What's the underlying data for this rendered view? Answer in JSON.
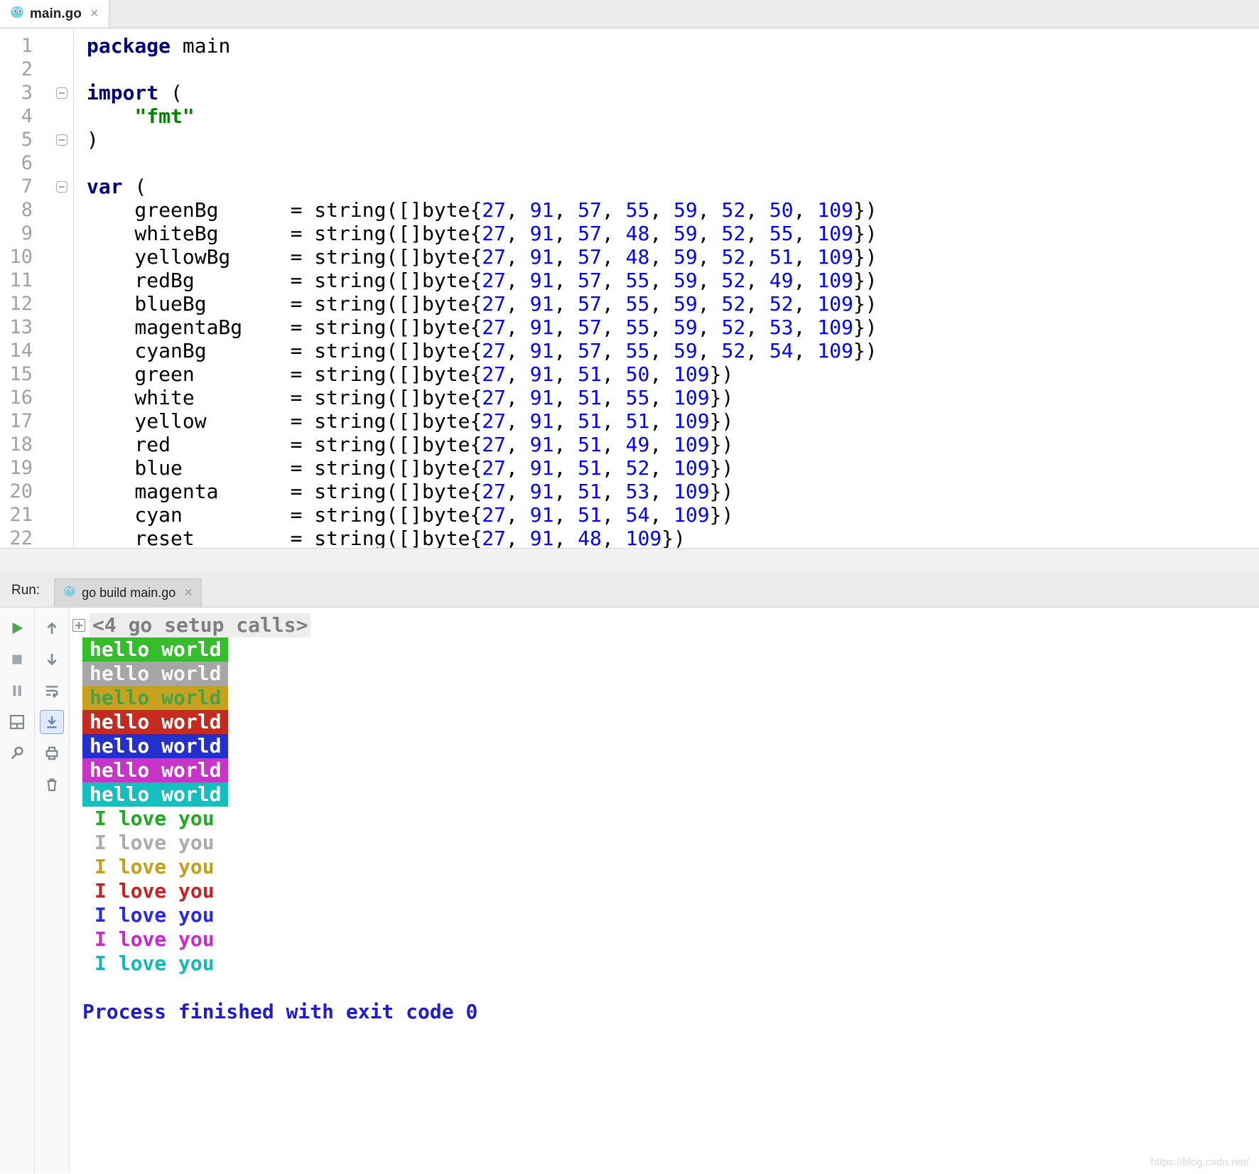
{
  "window": {
    "editor_tab": {
      "title": "main.go",
      "close": "×"
    }
  },
  "editor": {
    "lines": [
      {
        "n": 1,
        "tokens": [
          [
            "kw",
            "package"
          ],
          [
            "pl",
            " main"
          ]
        ]
      },
      {
        "n": 2,
        "tokens": []
      },
      {
        "n": 3,
        "fold": "open",
        "tokens": [
          [
            "kw",
            "import"
          ],
          [
            "pl",
            " ("
          ]
        ]
      },
      {
        "n": 4,
        "tokens": [
          [
            "pl",
            "    "
          ],
          [
            "str",
            "\"fmt\""
          ]
        ]
      },
      {
        "n": 5,
        "fold": "close",
        "tokens": [
          [
            "pl",
            ")"
          ]
        ]
      },
      {
        "n": 6,
        "tokens": []
      },
      {
        "n": 7,
        "fold": "open",
        "tokens": [
          [
            "kw",
            "var"
          ],
          [
            "pl",
            " ("
          ]
        ]
      },
      {
        "n": 8,
        "decl": {
          "name": "greenBg",
          "bytes": [
            27,
            91,
            57,
            55,
            59,
            52,
            50,
            109
          ]
        }
      },
      {
        "n": 9,
        "decl": {
          "name": "whiteBg",
          "bytes": [
            27,
            91,
            57,
            48,
            59,
            52,
            55,
            109
          ]
        }
      },
      {
        "n": 10,
        "decl": {
          "name": "yellowBg",
          "bytes": [
            27,
            91,
            57,
            48,
            59,
            52,
            51,
            109
          ]
        }
      },
      {
        "n": 11,
        "decl": {
          "name": "redBg",
          "bytes": [
            27,
            91,
            57,
            55,
            59,
            52,
            49,
            109
          ]
        }
      },
      {
        "n": 12,
        "decl": {
          "name": "blueBg",
          "bytes": [
            27,
            91,
            57,
            55,
            59,
            52,
            52,
            109
          ]
        }
      },
      {
        "n": 13,
        "decl": {
          "name": "magentaBg",
          "bytes": [
            27,
            91,
            57,
            55,
            59,
            52,
            53,
            109
          ]
        }
      },
      {
        "n": 14,
        "decl": {
          "name": "cyanBg",
          "bytes": [
            27,
            91,
            57,
            55,
            59,
            52,
            54,
            109
          ]
        }
      },
      {
        "n": 15,
        "decl": {
          "name": "green",
          "bytes": [
            27,
            91,
            51,
            50,
            109
          ]
        }
      },
      {
        "n": 16,
        "decl": {
          "name": "white",
          "bytes": [
            27,
            91,
            51,
            55,
            109
          ]
        }
      },
      {
        "n": 17,
        "decl": {
          "name": "yellow",
          "bytes": [
            27,
            91,
            51,
            51,
            109
          ]
        }
      },
      {
        "n": 18,
        "decl": {
          "name": "red",
          "bytes": [
            27,
            91,
            51,
            49,
            109
          ]
        }
      },
      {
        "n": 19,
        "decl": {
          "name": "blue",
          "bytes": [
            27,
            91,
            51,
            52,
            109
          ]
        }
      },
      {
        "n": 20,
        "decl": {
          "name": "magenta",
          "bytes": [
            27,
            91,
            51,
            53,
            109
          ]
        }
      },
      {
        "n": 21,
        "decl": {
          "name": "cyan",
          "bytes": [
            27,
            91,
            51,
            54,
            109
          ]
        }
      },
      {
        "n": 22,
        "decl": {
          "name": "reset",
          "bytes": [
            27,
            91,
            48,
            109
          ]
        }
      }
    ]
  },
  "run_panel": {
    "label": "Run:",
    "tab": {
      "title": "go build main.go",
      "close": "×"
    },
    "toolbar": {
      "primary": [
        {
          "id": "run"
        },
        {
          "id": "stop"
        },
        {
          "id": "pause"
        },
        {
          "id": "restore-layout"
        },
        {
          "id": "pin"
        }
      ],
      "secondary": [
        {
          "id": "up"
        },
        {
          "id": "down"
        },
        {
          "id": "soft-wrap"
        },
        {
          "id": "scroll-to-end",
          "selected": true
        },
        {
          "id": "print"
        },
        {
          "id": "trash"
        }
      ]
    },
    "console": {
      "setup_line": "<4 go setup calls>",
      "hello_text": "hello world",
      "love_text": "I love you",
      "hello_lines": [
        {
          "name": "green",
          "bg": "#35BE2B",
          "fg": "#FFFFFF"
        },
        {
          "name": "white",
          "bg": "#A6A6A6",
          "fg": "#F5F5F5"
        },
        {
          "name": "yellow",
          "bg": "#C9A21D",
          "fg": "#4AA147"
        },
        {
          "name": "red",
          "bg": "#C52B20",
          "fg": "#FFFFFF"
        },
        {
          "name": "blue",
          "bg": "#2430CE",
          "fg": "#FFFFFF"
        },
        {
          "name": "magenta",
          "bg": "#C834C8",
          "fg": "#FFFFFF"
        },
        {
          "name": "cyan",
          "bg": "#16BFBF",
          "fg": "#FFFFFF"
        }
      ],
      "love_lines": [
        {
          "name": "green",
          "fg": "#22A822"
        },
        {
          "name": "white",
          "fg": "#ABABAB"
        },
        {
          "name": "yellow",
          "fg": "#C79E1B"
        },
        {
          "name": "red",
          "fg": "#C62420"
        },
        {
          "name": "blue",
          "fg": "#2A2ADF"
        },
        {
          "name": "magenta",
          "fg": "#CA28CA"
        },
        {
          "name": "cyan",
          "fg": "#12B8B8"
        }
      ],
      "exit_line": "Process finished with exit code 0",
      "exit_color": "#1D1DC9"
    }
  },
  "watermark": "https://blog.csdn.net/"
}
